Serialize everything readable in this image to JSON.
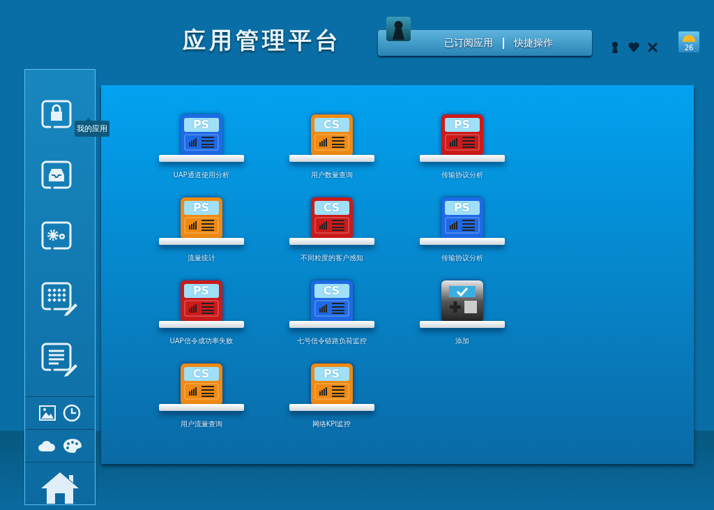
{
  "header": {
    "title": "应用管理平台",
    "nav": [
      {
        "label": "已订阅应用"
      },
      {
        "label": "快捷操作"
      }
    ],
    "weather": {
      "temperature": "26"
    }
  },
  "sidebar": {
    "tooltip": "我的应用"
  },
  "apps": [
    {
      "kind": "app",
      "badge": "PS",
      "color": "#1e6ae6",
      "label": "UAP通道使用分析"
    },
    {
      "kind": "app",
      "badge": "CS",
      "color": "#f08a12",
      "label": "用户数量查询"
    },
    {
      "kind": "app",
      "badge": "PS",
      "color": "#cc1a1a",
      "label": "传输协议分析"
    },
    {
      "kind": "app",
      "badge": "PS",
      "color": "#f08a12",
      "label": "流量统计"
    },
    {
      "kind": "app",
      "badge": "CS",
      "color": "#cc1a1a",
      "label": "不同粒度的客户感知"
    },
    {
      "kind": "app",
      "badge": "PS",
      "color": "#1e6ae6",
      "label": "传输协议分析"
    },
    {
      "kind": "app",
      "badge": "PS",
      "color": "#cc1a1a",
      "label": "UAP信令成功率失败"
    },
    {
      "kind": "app",
      "badge": "CS",
      "color": "#1e6ae6",
      "label": "七号信令链路负荷监控"
    },
    {
      "kind": "add",
      "label": "添加"
    },
    {
      "kind": "app",
      "badge": "CS",
      "color": "#f08a12",
      "label": "用户流量查询"
    },
    {
      "kind": "app",
      "badge": "PS",
      "color": "#f08a12",
      "label": "网络KPI监控"
    }
  ]
}
